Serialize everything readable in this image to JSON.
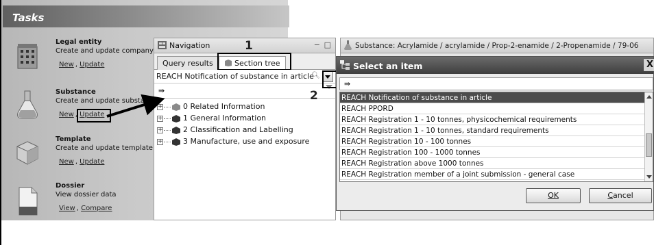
{
  "tasks": {
    "header": "Tasks",
    "items": [
      {
        "title": "Legal entity",
        "desc": "Create and update company",
        "links": [
          "New",
          "Update"
        ]
      },
      {
        "title": "Substance",
        "desc": "Create and update substa",
        "links": [
          "New",
          "Update"
        ]
      },
      {
        "title": "Template",
        "desc": "Create and update template",
        "links": [
          "New",
          "Update"
        ]
      },
      {
        "title": "Dossier",
        "desc": "View dossier data",
        "links": [
          "View",
          "Compare"
        ]
      }
    ]
  },
  "navigation": {
    "title": "Navigation",
    "window_controls": {
      "minimize": "−",
      "maximize": "□"
    },
    "tabs": [
      "Query results",
      "Section tree"
    ],
    "selected_template": "REACH Notification of substance in article",
    "filter_glyph": "⇛",
    "tree": [
      {
        "label": "0 Related Information"
      },
      {
        "label": "1 General Information"
      },
      {
        "label": "2 Classification and Labelling"
      },
      {
        "label": "3 Manufacture, use and exposure"
      }
    ]
  },
  "steps": [
    "1",
    "2"
  ],
  "substance_window": {
    "title": "Substance: Acrylamide / acrylamide / Prop-2-enamide / 2-Propenamide / 79-06"
  },
  "dialog": {
    "title": "Select an item",
    "close": "X",
    "filter_glyph": "⇛",
    "items": [
      "REACH Notification of substance in article",
      "REACH PPORD",
      "REACH Registration 1 - 10 tonnes, physicochemical requirements",
      "REACH Registration 1 - 10 tonnes, standard requirements",
      "REACH Registration 10 - 100 tonnes",
      "REACH Registration 100 - 1000 tonnes",
      "REACH Registration above 1000 tonnes",
      "REACH Registration member of a joint submission - general case"
    ],
    "selected_index": 0,
    "ok_label": "OK",
    "cancel_label": "Cancel",
    "colors": {
      "selection": "#4c4c4c",
      "titlebar": "#4a4a4a"
    }
  }
}
